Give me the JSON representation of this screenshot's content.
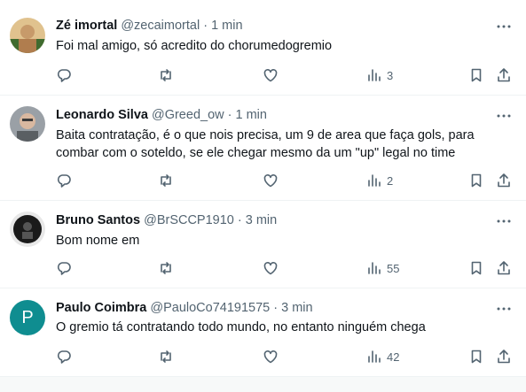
{
  "tweets": [
    {
      "name": "Zé imortal",
      "handle": "@zecaimortal",
      "sep": "·",
      "time": "1 min",
      "text": "Foi mal amigo, só acredito do chorumedogremio",
      "views": "3",
      "avatar": {
        "type": "photo",
        "colors": [
          "#c79a6a",
          "#3f6b2f",
          "#e0c28e"
        ]
      }
    },
    {
      "name": "Leonardo Silva",
      "handle": "@Greed_ow",
      "sep": "·",
      "time": "1 min",
      "text": "Baita contratação, é o que nois precisa, um 9 de area que faça gols, para combar com o soteldo, se ele chegar mesmo da um \"up\" legal no time",
      "views": "2",
      "avatar": {
        "type": "photo",
        "colors": [
          "#9aa0a6",
          "#d9b8a0",
          "#5a5f63"
        ]
      }
    },
    {
      "name": "Bruno Santos",
      "handle": "@BrSCCP1910",
      "sep": "·",
      "time": "3 min",
      "text": "Bom nome em",
      "views": "55",
      "avatar": {
        "type": "photo",
        "colors": [
          "#1a1a1a",
          "#e8e8e8",
          "#555555"
        ]
      }
    },
    {
      "name": "Paulo Coimbra",
      "handle": "@PauloCo74191575",
      "sep": "·",
      "time": "3 min",
      "text": "O gremio tá contratando todo mundo, no entanto ninguém chega",
      "views": "42",
      "avatar": {
        "type": "letter",
        "letter": "P",
        "bg": "#0f8d90",
        "fg": "#ffffff"
      }
    }
  ],
  "icons": {
    "more": "more-icon",
    "reply": "reply-icon",
    "retweet": "retweet-icon",
    "like": "like-icon",
    "views": "views-icon",
    "bookmark": "bookmark-icon",
    "share": "share-icon"
  },
  "colors": {
    "text": "#0f1419",
    "secondary": "#536471",
    "divider": "#eff3f4"
  }
}
